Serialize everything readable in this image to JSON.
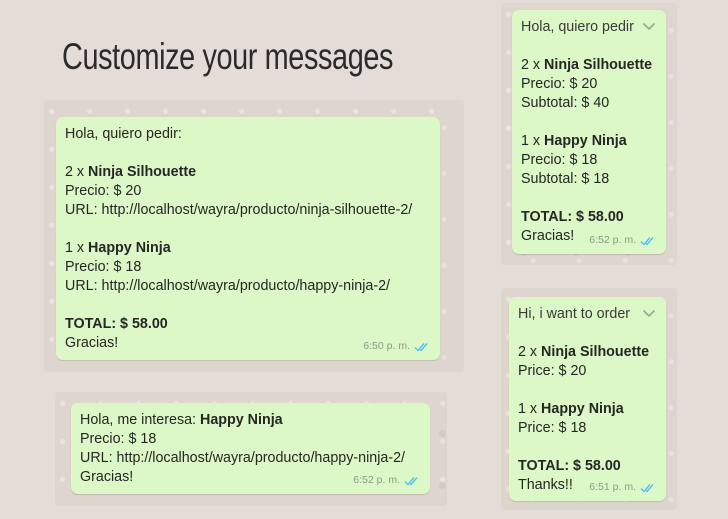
{
  "title": "Customize your messages",
  "icons": {
    "ticks": "double-check-icon",
    "dropdown": "chevron-down-icon"
  },
  "colors": {
    "bubble": "#dcf8c6",
    "ticks": "#4fc3f7",
    "page": "#e4dcd6"
  },
  "main_message": {
    "greeting": "Hola, quiero pedir:",
    "item1_prefix": "2 x ",
    "item1_name": "Ninja Silhouette",
    "item1_price": "Precio: $ 20",
    "item1_url": "URL: http://localhost/wayra/producto/ninja-silhouette-2/",
    "item2_prefix": "1 x ",
    "item2_name": "Happy Ninja",
    "item2_price": "Precio: $ 18",
    "item2_url": "URL: http://localhost/wayra/producto/happy-ninja-2/",
    "total": "TOTAL: $ 58.00",
    "thanks": "Gracias!",
    "time": "6:50 p. m."
  },
  "single_message": {
    "intro": "Hola, me interesa: ",
    "product": "Happy Ninja",
    "price": "Precio: $ 18",
    "url": "URL: http://localhost/wayra/producto/happy-ninja-2/",
    "thanks": "Gracias!",
    "time": "6:52 p. m."
  },
  "spanish_template": {
    "header": "Hola, quiero pedir",
    "item1_prefix": "2 x ",
    "item1_name": "Ninja Silhouette",
    "item1_price": "Precio: $ 20",
    "item1_subtotal": "Subtotal: $ 40",
    "item2_prefix": "1 x ",
    "item2_name": "Happy Ninja",
    "item2_price": "Precio: $ 18",
    "item2_subtotal": "Subtotal: $ 18",
    "total": "TOTAL: $ 58.00",
    "thanks": "Gracias!",
    "time": "6:52 p. m."
  },
  "english_template": {
    "header": "Hi, i want to order",
    "item1_prefix": "2 x ",
    "item1_name": "Ninja Silhouette",
    "item1_price": "Price: $ 20",
    "item2_prefix": "1 x ",
    "item2_name": "Happy Ninja",
    "item2_price": "Price: $ 18",
    "total": "TOTAL: $ 58.00",
    "thanks": "Thanks!!",
    "time": "6:51 p. m."
  }
}
